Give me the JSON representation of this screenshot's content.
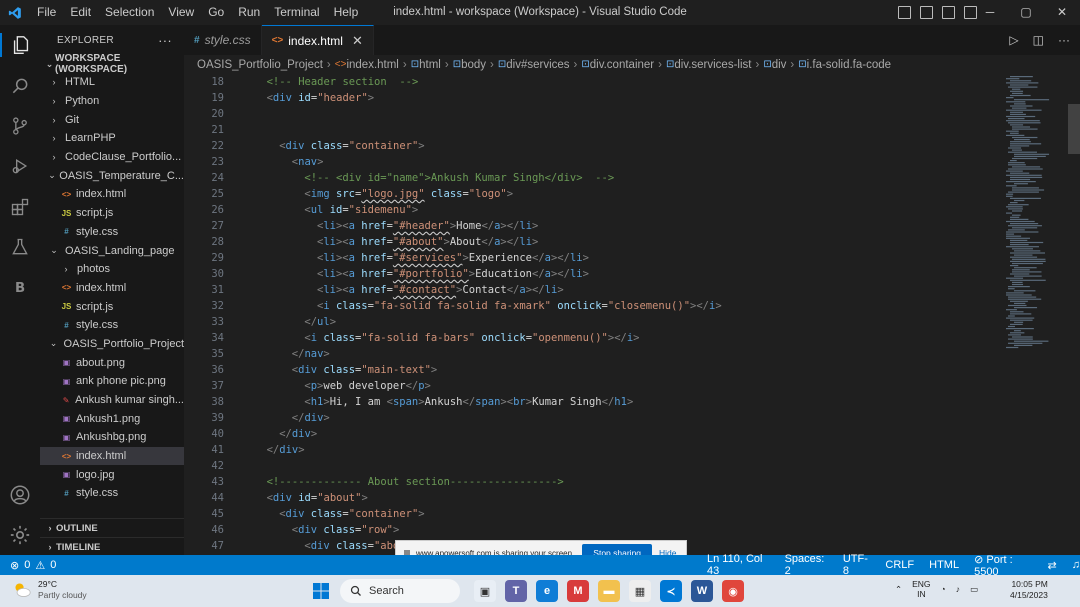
{
  "titlebar": {
    "menu": [
      "File",
      "Edit",
      "Selection",
      "View",
      "Go",
      "Run",
      "Terminal",
      "Help"
    ],
    "window_title": "index.html - workspace (Workspace) - Visual Studio Code",
    "minimize": "─",
    "maximize": "▢",
    "close": "✕"
  },
  "explorer": {
    "title": "EXPLORER",
    "more": "···",
    "workspace": "WORKSPACE (WORKSPACE)",
    "items": [
      {
        "label": "HTML",
        "depth": 1,
        "kind": "folder",
        "open": false
      },
      {
        "label": "Python",
        "depth": 1,
        "kind": "folder",
        "open": false
      },
      {
        "label": "Git",
        "depth": 1,
        "kind": "folder",
        "open": false
      },
      {
        "label": "LearnPHP",
        "depth": 1,
        "kind": "folder",
        "open": false
      },
      {
        "label": "CodeClause_Portfolio...",
        "depth": 1,
        "kind": "folder",
        "open": false
      },
      {
        "label": "OASIS_Temperature_C...",
        "depth": 1,
        "kind": "folder",
        "open": true
      },
      {
        "label": "index.html",
        "depth": 2,
        "kind": "html"
      },
      {
        "label": "script.js",
        "depth": 2,
        "kind": "js"
      },
      {
        "label": "style.css",
        "depth": 2,
        "kind": "css"
      },
      {
        "label": "OASIS_Landing_page",
        "depth": 1,
        "kind": "folder",
        "open": true
      },
      {
        "label": "photos",
        "depth": 2,
        "kind": "folder",
        "open": false
      },
      {
        "label": "index.html",
        "depth": 2,
        "kind": "html"
      },
      {
        "label": "script.js",
        "depth": 2,
        "kind": "js"
      },
      {
        "label": "style.css",
        "depth": 2,
        "kind": "css"
      },
      {
        "label": "OASIS_Portfolio_Project",
        "depth": 1,
        "kind": "folder",
        "open": true
      },
      {
        "label": "about.png",
        "depth": 2,
        "kind": "img"
      },
      {
        "label": "ank phone pic.png",
        "depth": 2,
        "kind": "img"
      },
      {
        "label": "Ankush kumar singh...",
        "depth": 2,
        "kind": "pdf"
      },
      {
        "label": "Ankush1.png",
        "depth": 2,
        "kind": "img"
      },
      {
        "label": "Ankushbg.png",
        "depth": 2,
        "kind": "img"
      },
      {
        "label": "index.html",
        "depth": 2,
        "kind": "html",
        "selected": true
      },
      {
        "label": "logo.jpg",
        "depth": 2,
        "kind": "img"
      },
      {
        "label": "style.css",
        "depth": 2,
        "kind": "css"
      }
    ],
    "outline": "OUTLINE",
    "timeline": "TIMELINE"
  },
  "tabs": [
    {
      "label": "style.css",
      "icon": "#",
      "active": false,
      "italic": true
    },
    {
      "label": "index.html",
      "icon": "<>",
      "active": true,
      "close": "✕"
    }
  ],
  "breadcrumb": [
    "OASIS_Portfolio_Project",
    "index.html",
    "html",
    "body",
    "div#services",
    "div.container",
    "div.services-list",
    "div",
    "i.fa-solid.fa-code"
  ],
  "editor": {
    "lines": [
      {
        "n": 18,
        "i": 1,
        "t": [
          [
            "cm",
            "<!-- Header section  -->"
          ]
        ]
      },
      {
        "n": 19,
        "i": 1,
        "t": [
          [
            "pn",
            "<"
          ],
          [
            "tg",
            "div"
          ],
          [
            "at",
            " id"
          ],
          [
            "tx",
            "="
          ],
          [
            "st",
            "\"header\""
          ],
          [
            "pn",
            ">"
          ]
        ]
      },
      {
        "n": 20,
        "i": 0,
        "t": []
      },
      {
        "n": 21,
        "i": 0,
        "t": []
      },
      {
        "n": 22,
        "i": 2,
        "t": [
          [
            "pn",
            "<"
          ],
          [
            "tg",
            "div"
          ],
          [
            "at",
            " class"
          ],
          [
            "tx",
            "="
          ],
          [
            "st",
            "\"container\""
          ],
          [
            "pn",
            ">"
          ]
        ]
      },
      {
        "n": 23,
        "i": 3,
        "t": [
          [
            "pn",
            "<"
          ],
          [
            "tg",
            "nav"
          ],
          [
            "pn",
            ">"
          ]
        ]
      },
      {
        "n": 24,
        "i": 4,
        "t": [
          [
            "cm",
            "<!-- <div id=\"name\">Ankush Kumar Singh</div>  -->"
          ]
        ]
      },
      {
        "n": 25,
        "i": 4,
        "t": [
          [
            "pn",
            "<"
          ],
          [
            "tg",
            "img"
          ],
          [
            "at",
            " src"
          ],
          [
            "tx",
            "="
          ],
          [
            "st",
            "\"logo.jpg\""
          ],
          [
            "at",
            " class"
          ],
          [
            "tx",
            "="
          ],
          [
            "st",
            "\"logo\""
          ],
          [
            "pn",
            ">"
          ]
        ]
      },
      {
        "n": 26,
        "i": 4,
        "t": [
          [
            "pn",
            "<"
          ],
          [
            "tg",
            "ul"
          ],
          [
            "at",
            " id"
          ],
          [
            "tx",
            "="
          ],
          [
            "st",
            "\"sidemenu\""
          ],
          [
            "pn",
            ">"
          ]
        ]
      },
      {
        "n": 27,
        "i": 5,
        "t": [
          [
            "pn",
            "<"
          ],
          [
            "tg",
            "li"
          ],
          [
            "pn",
            "><"
          ],
          [
            "tg",
            "a"
          ],
          [
            "at",
            " href"
          ],
          [
            "tx",
            "="
          ],
          [
            "st",
            "\"#header\""
          ],
          [
            "pn",
            ">"
          ],
          [
            "tx",
            "Home"
          ],
          [
            "pn",
            "</"
          ],
          [
            "tg",
            "a"
          ],
          [
            "pn",
            "></"
          ],
          [
            "tg",
            "li"
          ],
          [
            "pn",
            ">"
          ]
        ]
      },
      {
        "n": 28,
        "i": 5,
        "t": [
          [
            "pn",
            "<"
          ],
          [
            "tg",
            "li"
          ],
          [
            "pn",
            "><"
          ],
          [
            "tg",
            "a"
          ],
          [
            "at",
            " href"
          ],
          [
            "tx",
            "="
          ],
          [
            "st",
            "\"#about\""
          ],
          [
            "pn",
            ">"
          ],
          [
            "tx",
            "About"
          ],
          [
            "pn",
            "</"
          ],
          [
            "tg",
            "a"
          ],
          [
            "pn",
            "></"
          ],
          [
            "tg",
            "li"
          ],
          [
            "pn",
            ">"
          ]
        ]
      },
      {
        "n": 29,
        "i": 5,
        "t": [
          [
            "pn",
            "<"
          ],
          [
            "tg",
            "li"
          ],
          [
            "pn",
            "><"
          ],
          [
            "tg",
            "a"
          ],
          [
            "at",
            " href"
          ],
          [
            "tx",
            "="
          ],
          [
            "st",
            "\"#services\""
          ],
          [
            "pn",
            ">"
          ],
          [
            "tx",
            "Experience"
          ],
          [
            "pn",
            "</"
          ],
          [
            "tg",
            "a"
          ],
          [
            "pn",
            "></"
          ],
          [
            "tg",
            "li"
          ],
          [
            "pn",
            ">"
          ]
        ]
      },
      {
        "n": 30,
        "i": 5,
        "t": [
          [
            "pn",
            "<"
          ],
          [
            "tg",
            "li"
          ],
          [
            "pn",
            "><"
          ],
          [
            "tg",
            "a"
          ],
          [
            "at",
            " href"
          ],
          [
            "tx",
            "="
          ],
          [
            "st",
            "\"#portfolio\""
          ],
          [
            "pn",
            ">"
          ],
          [
            "tx",
            "Education"
          ],
          [
            "pn",
            "</"
          ],
          [
            "tg",
            "a"
          ],
          [
            "pn",
            "></"
          ],
          [
            "tg",
            "li"
          ],
          [
            "pn",
            ">"
          ]
        ]
      },
      {
        "n": 31,
        "i": 5,
        "t": [
          [
            "pn",
            "<"
          ],
          [
            "tg",
            "li"
          ],
          [
            "pn",
            "><"
          ],
          [
            "tg",
            "a"
          ],
          [
            "at",
            " href"
          ],
          [
            "tx",
            "="
          ],
          [
            "st",
            "\"#contact\""
          ],
          [
            "pn",
            ">"
          ],
          [
            "tx",
            "Contact"
          ],
          [
            "pn",
            "</"
          ],
          [
            "tg",
            "a"
          ],
          [
            "pn",
            "></"
          ],
          [
            "tg",
            "li"
          ],
          [
            "pn",
            ">"
          ]
        ]
      },
      {
        "n": 32,
        "i": 5,
        "t": [
          [
            "pn",
            "<"
          ],
          [
            "tg",
            "i"
          ],
          [
            "at",
            " class"
          ],
          [
            "tx",
            "="
          ],
          [
            "st",
            "\"fa-solid fa-solid fa-xmark\""
          ],
          [
            "at",
            " onclick"
          ],
          [
            "tx",
            "="
          ],
          [
            "st",
            "\"closemenu()\""
          ],
          [
            "pn",
            "></"
          ],
          [
            "tg",
            "i"
          ],
          [
            "pn",
            ">"
          ]
        ]
      },
      {
        "n": 33,
        "i": 4,
        "t": [
          [
            "pn",
            "</"
          ],
          [
            "tg",
            "ul"
          ],
          [
            "pn",
            ">"
          ]
        ]
      },
      {
        "n": 34,
        "i": 4,
        "t": [
          [
            "pn",
            "<"
          ],
          [
            "tg",
            "i"
          ],
          [
            "at",
            " class"
          ],
          [
            "tx",
            "="
          ],
          [
            "st",
            "\"fa-solid fa-bars\""
          ],
          [
            "at",
            " onclick"
          ],
          [
            "tx",
            "="
          ],
          [
            "st",
            "\"openmenu()\""
          ],
          [
            "pn",
            "></"
          ],
          [
            "tg",
            "i"
          ],
          [
            "pn",
            ">"
          ]
        ]
      },
      {
        "n": 35,
        "i": 3,
        "t": [
          [
            "pn",
            "</"
          ],
          [
            "tg",
            "nav"
          ],
          [
            "pn",
            ">"
          ]
        ]
      },
      {
        "n": 36,
        "i": 3,
        "t": [
          [
            "pn",
            "<"
          ],
          [
            "tg",
            "div"
          ],
          [
            "at",
            " class"
          ],
          [
            "tx",
            "="
          ],
          [
            "st",
            "\"main-text\""
          ],
          [
            "pn",
            ">"
          ]
        ]
      },
      {
        "n": 37,
        "i": 4,
        "t": [
          [
            "pn",
            "<"
          ],
          [
            "tg",
            "p"
          ],
          [
            "pn",
            ">"
          ],
          [
            "tx",
            "web developer"
          ],
          [
            "pn",
            "</"
          ],
          [
            "tg",
            "p"
          ],
          [
            "pn",
            ">"
          ]
        ]
      },
      {
        "n": 38,
        "i": 4,
        "t": [
          [
            "pn",
            "<"
          ],
          [
            "tg",
            "h1"
          ],
          [
            "pn",
            ">"
          ],
          [
            "tx",
            "Hi, I am "
          ],
          [
            "pn",
            "<"
          ],
          [
            "tg",
            "span"
          ],
          [
            "pn",
            ">"
          ],
          [
            "tx",
            "Ankush"
          ],
          [
            "pn",
            "</"
          ],
          [
            "tg",
            "span"
          ],
          [
            "pn",
            "><"
          ],
          [
            "tg",
            "br"
          ],
          [
            "pn",
            ">"
          ],
          [
            "tx",
            "Kumar Singh"
          ],
          [
            "pn",
            "</"
          ],
          [
            "tg",
            "h1"
          ],
          [
            "pn",
            ">"
          ]
        ]
      },
      {
        "n": 39,
        "i": 3,
        "t": [
          [
            "pn",
            "</"
          ],
          [
            "tg",
            "div"
          ],
          [
            "pn",
            ">"
          ]
        ]
      },
      {
        "n": 40,
        "i": 2,
        "t": [
          [
            "pn",
            "</"
          ],
          [
            "tg",
            "div"
          ],
          [
            "pn",
            ">"
          ]
        ]
      },
      {
        "n": 41,
        "i": 1,
        "t": [
          [
            "pn",
            "</"
          ],
          [
            "tg",
            "div"
          ],
          [
            "pn",
            ">"
          ]
        ]
      },
      {
        "n": 42,
        "i": 0,
        "t": []
      },
      {
        "n": 43,
        "i": 1,
        "t": [
          [
            "cm",
            "<!------------- About section----------------->"
          ]
        ]
      },
      {
        "n": 44,
        "i": 1,
        "t": [
          [
            "pn",
            "<"
          ],
          [
            "tg",
            "div"
          ],
          [
            "at",
            " id"
          ],
          [
            "tx",
            "="
          ],
          [
            "st",
            "\"about\""
          ],
          [
            "pn",
            ">"
          ]
        ]
      },
      {
        "n": 45,
        "i": 2,
        "t": [
          [
            "pn",
            "<"
          ],
          [
            "tg",
            "div"
          ],
          [
            "at",
            " class"
          ],
          [
            "tx",
            "="
          ],
          [
            "st",
            "\"container\""
          ],
          [
            "pn",
            ">"
          ]
        ]
      },
      {
        "n": 46,
        "i": 3,
        "t": [
          [
            "pn",
            "<"
          ],
          [
            "tg",
            "div"
          ],
          [
            "at",
            " class"
          ],
          [
            "tx",
            "="
          ],
          [
            "st",
            "\"row\""
          ],
          [
            "pn",
            ">"
          ]
        ]
      },
      {
        "n": 47,
        "i": 4,
        "t": [
          [
            "pn",
            "<"
          ],
          [
            "tg",
            "div"
          ],
          [
            "at",
            " class"
          ],
          [
            "tx",
            "="
          ],
          [
            "st",
            "\"abo"
          ]
        ]
      }
    ]
  },
  "share_notice": {
    "text": "www.apowersoft.com is sharing your screen.",
    "stop_label": "Stop sharing",
    "hide_label": "Hide"
  },
  "statusbar": {
    "errors": "0",
    "warnings": "0",
    "position": "Ln 110, Col 43",
    "spaces": "Spaces: 2",
    "encoding": "UTF-8",
    "eol": "CRLF",
    "language": "HTML",
    "port": "Port : 5500"
  },
  "taskbar": {
    "temperature": "29°C",
    "weather": "Partly cloudy",
    "search_label": "Search",
    "lang_top": "ENG",
    "lang_bottom": "IN",
    "time": "10:05 PM",
    "date": "4/15/2023"
  },
  "colors": {
    "accent": "#007acc",
    "editor_bg": "#1f1f1f",
    "tag": "#569cd6",
    "attr": "#9cdcfe",
    "string": "#ce9178",
    "comment": "#6a9955"
  }
}
